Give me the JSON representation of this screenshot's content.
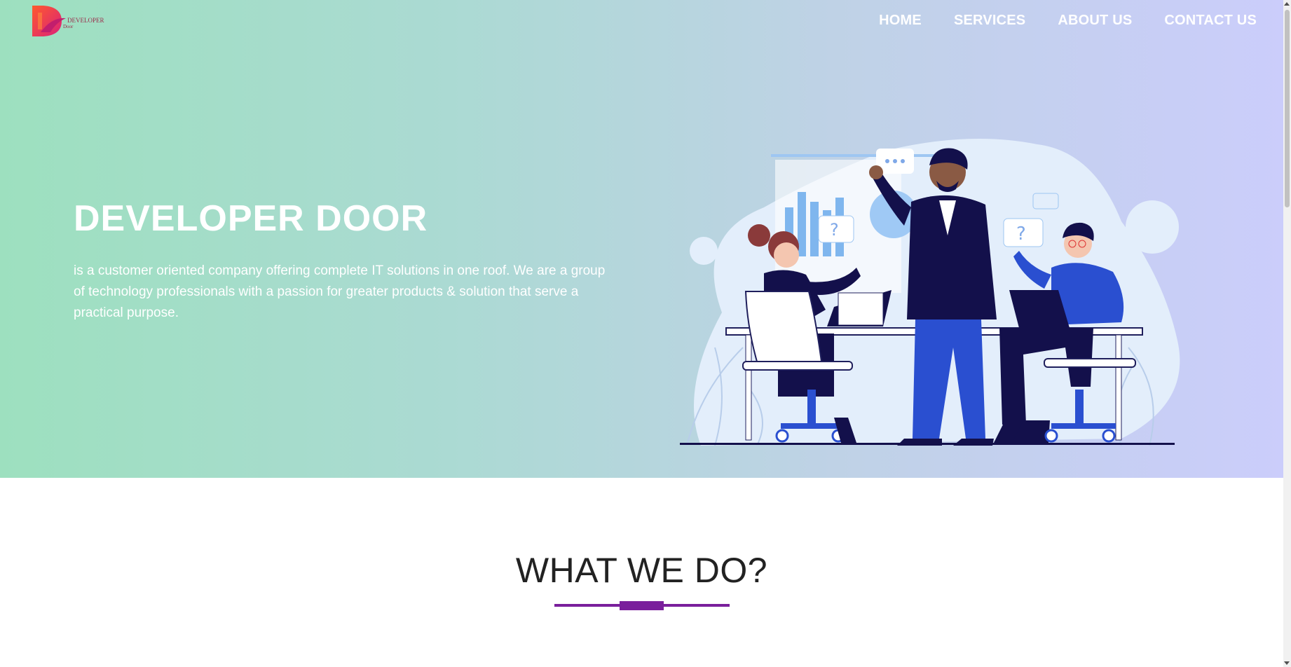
{
  "brand": {
    "logo_line1": "DEVELOPER",
    "logo_line2": "Door",
    "logo_icon": "developer-door-logo",
    "logo_colors": [
      "#ff4e3a",
      "#e0257a"
    ]
  },
  "nav": {
    "items": [
      {
        "label": "HOME"
      },
      {
        "label": "SERVICES"
      },
      {
        "label": "ABOUT US"
      },
      {
        "label": "CONTACT US"
      }
    ]
  },
  "hero": {
    "title": "DEVELOPER DOOR",
    "description": "is a customer oriented company offering complete IT solutions in one roof. We are a group of technology professionals with a passion for greater products & solution that serve a practical purpose.",
    "gradient": [
      "#9de0bf",
      "#cbcdfb"
    ],
    "illustration": "team-meeting-illustration"
  },
  "section": {
    "title": "WHAT WE DO?",
    "accent_color": "#7a1f9c"
  }
}
